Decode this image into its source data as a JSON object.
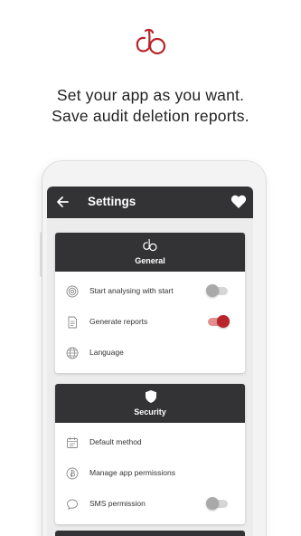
{
  "brand": {
    "logo_icon": "cb-monogram-logo",
    "color": "#b8242a"
  },
  "headline": {
    "line1": "Set your app as you want.",
    "line2": "Save audit deletion reports."
  },
  "app": {
    "appbar": {
      "title": "Settings",
      "back_icon": "arrow-left-icon",
      "favorite_icon": "heart-icon",
      "bg_color": "#333335"
    },
    "sections": [
      {
        "title": "General",
        "icon": "cb-logo-icon",
        "items": [
          {
            "label": "Start analysing with start",
            "icon": "target-icon",
            "toggle": true,
            "on": false
          },
          {
            "label": "Generate reports",
            "icon": "document-icon",
            "toggle": true,
            "on": true
          },
          {
            "label": "Language",
            "icon": "globe-icon",
            "toggle": false
          }
        ]
      },
      {
        "title": "Security",
        "icon": "shield-icon",
        "items": [
          {
            "label": "Default method",
            "icon": "calendar-icon",
            "toggle": false
          },
          {
            "label": "Manage app permissions",
            "icon": "bitcoin-icon",
            "toggle": false
          },
          {
            "label": "SMS permission",
            "icon": "chat-bubble-icon",
            "toggle": true,
            "on": false
          }
        ]
      }
    ]
  },
  "colors": {
    "accent": "#b8242a",
    "toggle_on_track": "#e2908f",
    "toggle_off_track": "#d6d6d6"
  }
}
